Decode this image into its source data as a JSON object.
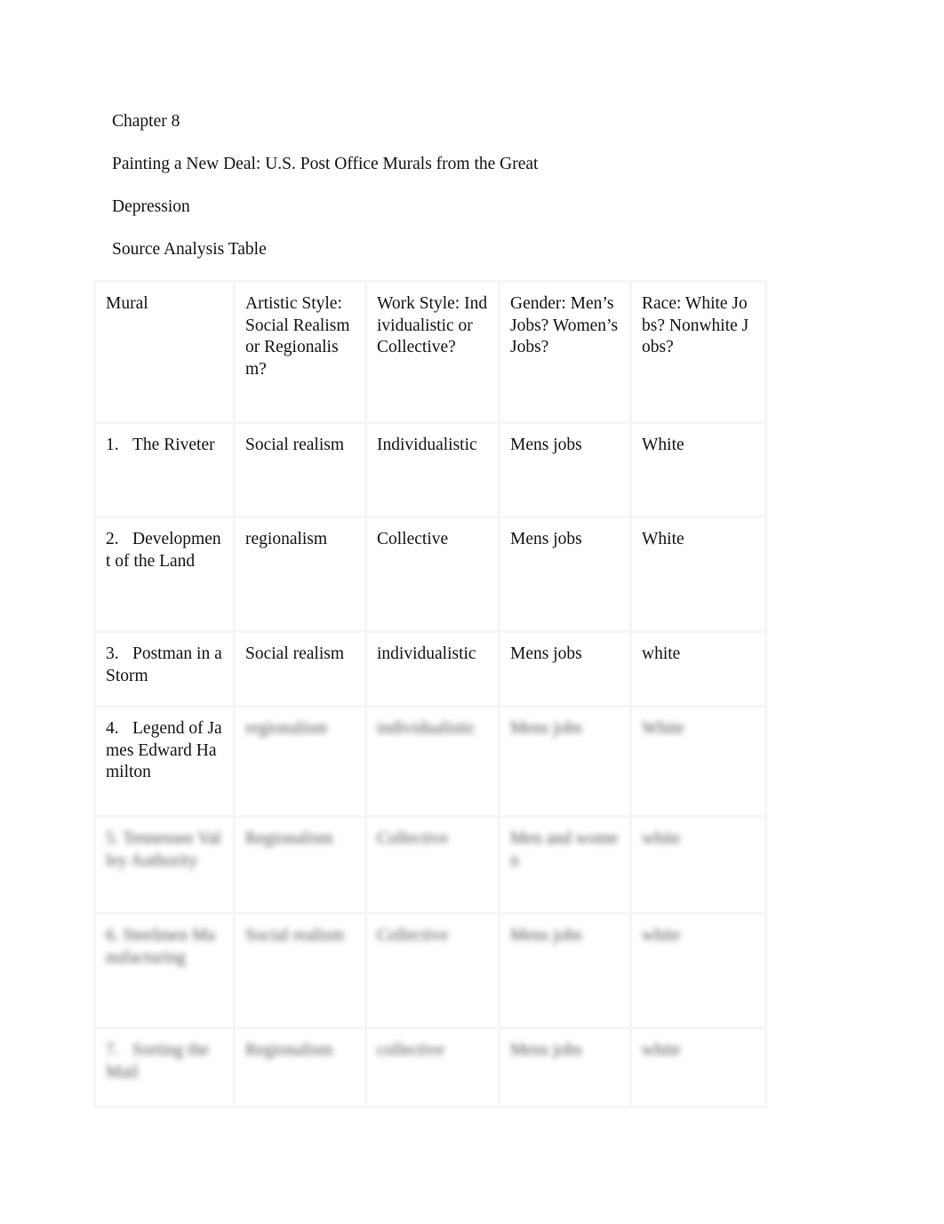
{
  "document": {
    "chapter": "Chapter 8",
    "title_line1": "Painting a New Deal: U.S. Post Office Murals from the Great",
    "title_line2": "Depression",
    "table_title": "Source Analysis Table"
  },
  "table": {
    "headers": [
      "Mural",
      "Artistic Style: Social Realism or Regionalism?",
      "Work Style: Individualistic or Collective?",
      "Gender: Men’s Jobs? Women’s Jobs?",
      "Race: White Jobs? Nonwhite Jobs?"
    ],
    "rows": [
      {
        "num": "1.",
        "mural": "The Riveter",
        "style": "Social realism",
        "work": "Individualistic",
        "gender": "Mens jobs",
        "race": "White",
        "blurred": false
      },
      {
        "num": "2.",
        "mural": "Development of the Land",
        "style": "regionalism",
        "work": "Collective",
        "gender": "Mens jobs",
        "race": "White",
        "blurred": false
      },
      {
        "num": "3.",
        "mural": "Postman in a Storm",
        "style": "Social realism",
        "work": "individualistic",
        "gender": "Mens jobs",
        "race": "white",
        "blurred": false
      },
      {
        "num": "4.",
        "mural": "Legend of James Edward Hamilton",
        "style": "regionalism",
        "work": "individualistic",
        "gender": "Mens jobs",
        "race": "White",
        "blurred": "partial"
      },
      {
        "num": "5.",
        "mural": "Tennessee Valley Authority",
        "style": "Regionalism",
        "work": "Collective",
        "gender": "Men and women",
        "race": "white",
        "blurred": true
      },
      {
        "num": "6.",
        "mural": "Steelmen Manufacturing",
        "style": "Social realism",
        "work": "Collective",
        "gender": "Mens jobs",
        "race": "white",
        "blurred": true
      },
      {
        "num": "7.",
        "mural": "Sorting the Mail",
        "style": "Regionalism",
        "work": "collective",
        "gender": "Mens jobs",
        "race": "white",
        "blurred": true
      }
    ]
  }
}
